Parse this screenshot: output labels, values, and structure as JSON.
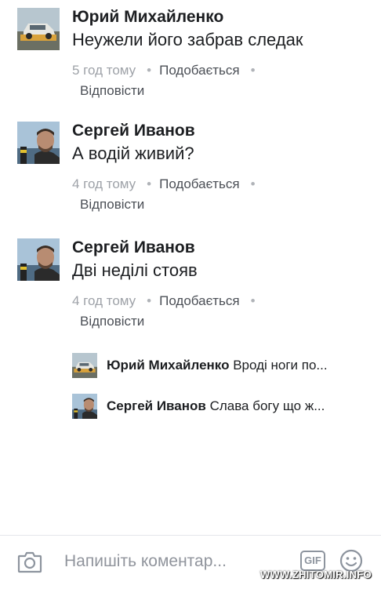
{
  "comments": [
    {
      "author": "Юрий Михайленко",
      "text": "Неужели його забрав следак",
      "time": "5 год тому",
      "like_label": "Подобається",
      "reply_label": "Відповісти",
      "avatar_icon": "car-tow-truck-avatar"
    },
    {
      "author": "Сергей Иванов",
      "text": "А водій живий?",
      "time": "4 год тому",
      "like_label": "Подобається",
      "reply_label": "Відповісти",
      "avatar_icon": "man-portrait-avatar"
    },
    {
      "author": "Сергей Иванов",
      "text": "Дві неділі стояв",
      "time": "4 год тому",
      "like_label": "Подобається",
      "reply_label": "Відповісти",
      "avatar_icon": "man-portrait-avatar"
    }
  ],
  "replies": [
    {
      "author": "Юрий Михайленко",
      "text": "Вроді ноги по..."
    },
    {
      "author": "Сергей Иванов",
      "text": "Слава богу що ж..."
    }
  ],
  "composer": {
    "placeholder": "Напишіть коментар...",
    "gif_label": "GIF"
  },
  "separator": "•",
  "watermark": "WWW.ZHITOMIR.INFO",
  "colors": {
    "text": "#1c1e21",
    "meta": "#90949c",
    "link": "#4b4f56",
    "icon": "#8d949e"
  }
}
